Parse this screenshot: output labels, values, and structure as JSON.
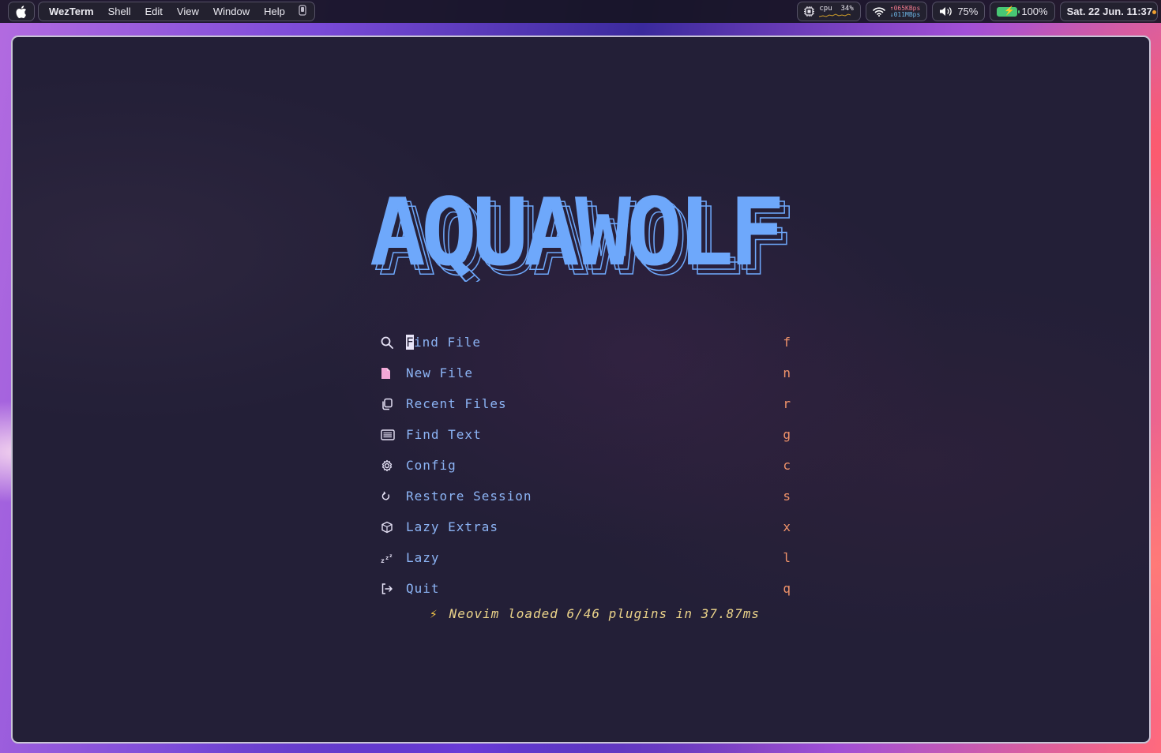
{
  "menubar": {
    "app_name": "WezTerm",
    "menus": [
      "Shell",
      "Edit",
      "View",
      "Window",
      "Help"
    ],
    "status": {
      "cpu_label": "cpu",
      "cpu_percent": "34%",
      "net_up": "065KBps",
      "net_down": "011MBps",
      "volume": "75%",
      "battery": "100%",
      "datetime": "Sat. 22 Jun. 11:37"
    }
  },
  "dashboard": {
    "logo": "AQUAWOLF",
    "entries": [
      {
        "icon": "search-icon",
        "cursor_char": "F",
        "label_rest": "ind File",
        "key": "f"
      },
      {
        "icon": "file-icon",
        "label": "New File",
        "key": "n"
      },
      {
        "icon": "recent-files-icon",
        "label": "Recent Files",
        "key": "r"
      },
      {
        "icon": "find-text-icon",
        "label": "Find Text",
        "key": "g"
      },
      {
        "icon": "gear-icon",
        "label": "Config",
        "key": "c"
      },
      {
        "icon": "restore-icon",
        "label": "Restore Session",
        "key": "s"
      },
      {
        "icon": "box-icon",
        "label": "Lazy Extras",
        "key": "x"
      },
      {
        "icon": "sleep-icon",
        "label": "Lazy",
        "key": "l"
      },
      {
        "icon": "exit-icon",
        "label": "Quit",
        "key": "q"
      }
    ],
    "footer": "Neovim loaded 6/46 plugins in 37.87ms"
  },
  "colors": {
    "logo": "#6ea8fb",
    "label": "#8cb4f5",
    "key": "#f0936a",
    "footer": "#ecd48a",
    "background": "#231f37"
  }
}
